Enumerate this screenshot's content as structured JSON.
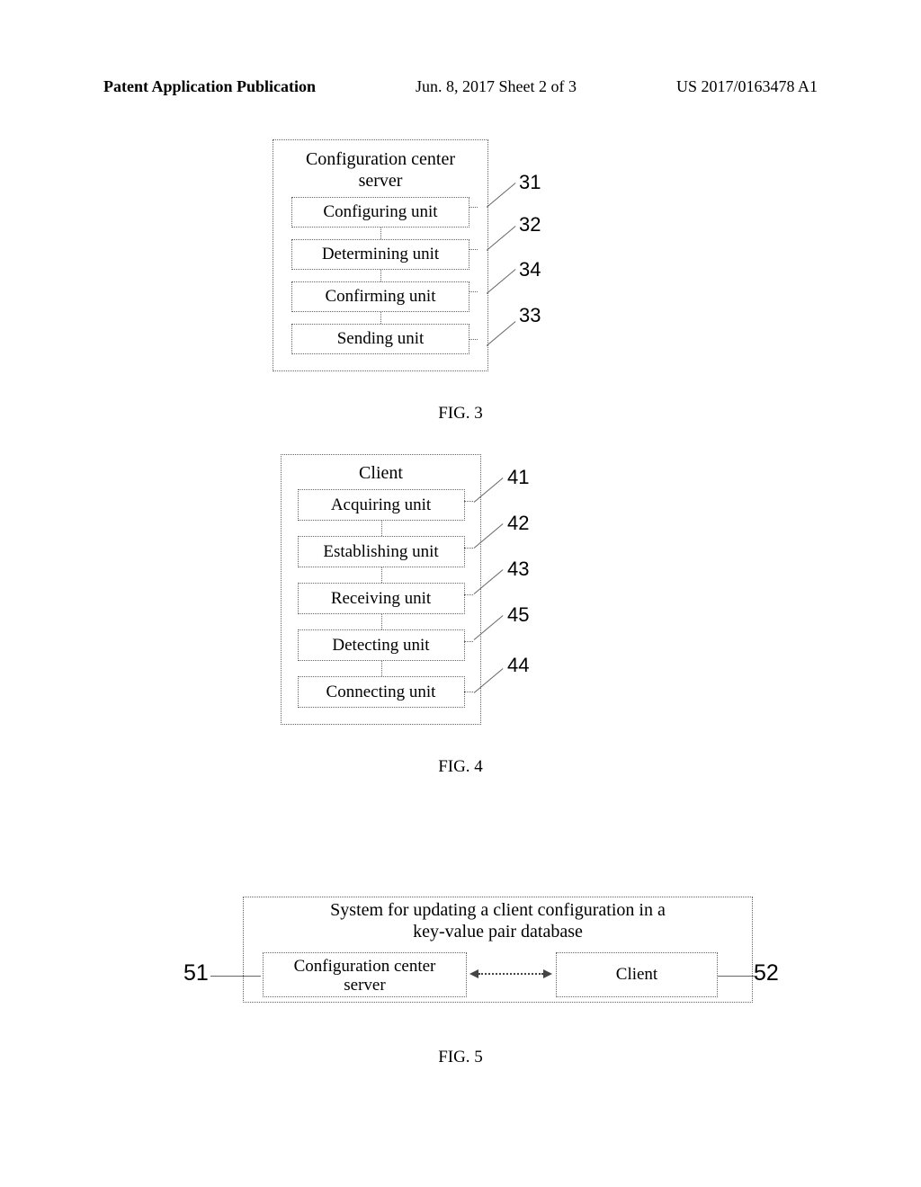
{
  "header": {
    "pub_type": "Patent Application Publication",
    "date_sheet": "Jun. 8, 2017   Sheet 2 of 3",
    "pub_number": "US 2017/0163478 A1"
  },
  "fig3": {
    "caption": "FIG. 3",
    "outer_title_l1": "Configuration center",
    "outer_title_l2": "server",
    "units": {
      "u1": {
        "label": "Configuring unit",
        "callout": "31"
      },
      "u2": {
        "label": "Determining unit",
        "callout": "32"
      },
      "u3": {
        "label": "Confirming unit",
        "callout": "34"
      },
      "u4": {
        "label": "Sending unit",
        "callout": "33"
      }
    }
  },
  "fig4": {
    "caption": "FIG. 4",
    "outer_title": "Client",
    "units": {
      "u1": {
        "label": "Acquiring unit",
        "callout": "41"
      },
      "u2": {
        "label": "Establishing unit",
        "callout": "42"
      },
      "u3": {
        "label": "Receiving unit",
        "callout": "43"
      },
      "u4": {
        "label": "Detecting unit",
        "callout": "45"
      },
      "u5": {
        "label": "Connecting unit",
        "callout": "44"
      }
    }
  },
  "fig5": {
    "caption": "FIG. 5",
    "title_l1": "System for updating a client configuration in a",
    "title_l2": "key-value pair database",
    "server_box_l1": "Configuration center",
    "server_box_l2": "server",
    "client_box": "Client",
    "callouts": {
      "server": "51",
      "client": "52"
    }
  },
  "chart_data": {
    "type": "diagram",
    "figures": [
      {
        "id": "FIG.3",
        "container": "Configuration center server",
        "units": [
          {
            "name": "Configuring unit",
            "ref": 31
          },
          {
            "name": "Determining unit",
            "ref": 32
          },
          {
            "name": "Confirming unit",
            "ref": 34
          },
          {
            "name": "Sending unit",
            "ref": 33
          }
        ],
        "flow": [
          [
            31,
            32
          ],
          [
            32,
            34
          ],
          [
            34,
            33
          ]
        ]
      },
      {
        "id": "FIG.4",
        "container": "Client",
        "units": [
          {
            "name": "Acquiring unit",
            "ref": 41
          },
          {
            "name": "Establishing unit",
            "ref": 42
          },
          {
            "name": "Receiving unit",
            "ref": 43
          },
          {
            "name": "Detecting unit",
            "ref": 45
          },
          {
            "name": "Connecting unit",
            "ref": 44
          }
        ],
        "flow": [
          [
            41,
            42
          ],
          [
            42,
            43
          ],
          [
            43,
            45
          ],
          [
            45,
            44
          ]
        ]
      },
      {
        "id": "FIG.5",
        "container": "System for updating a client configuration in a key-value pair database",
        "nodes": [
          {
            "name": "Configuration center server",
            "ref": 51
          },
          {
            "name": "Client",
            "ref": 52
          }
        ],
        "edge": {
          "from": 51,
          "to": 52,
          "bidirectional": true
        }
      }
    ]
  }
}
